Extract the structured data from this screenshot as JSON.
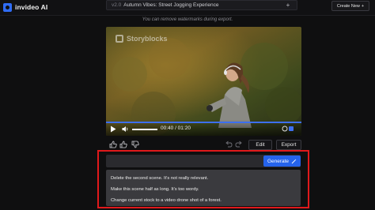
{
  "app": {
    "name": "invideo AI",
    "logo_icon": "invideo-logo-icon"
  },
  "project": {
    "version": "v2.0",
    "title": "Autumn Vibes: Street Jogging Experience"
  },
  "header": {
    "create_new_label": "Create New"
  },
  "notice": "You can remove watermarks during export.",
  "video": {
    "watermark_text": "Storyblocks",
    "current_time": "00:40",
    "duration": "01:20",
    "time_display": "00:40 / 01:20",
    "progress_fraction": 0.5,
    "volume_fraction": 1.0
  },
  "actions": {
    "edit_label": "Edit",
    "export_label": "Export"
  },
  "prompt": {
    "input_value": "",
    "generate_label": "Generate",
    "suggestions": [
      "Delete the second scene. It's not really relevant.",
      "Make this scene half as long. It's too wordy.",
      "Change current stock to a video drone shot of a forest."
    ]
  },
  "colors": {
    "accent": "#2563eb",
    "highlight_border": "#e0191b",
    "background": "#0f0f10"
  }
}
